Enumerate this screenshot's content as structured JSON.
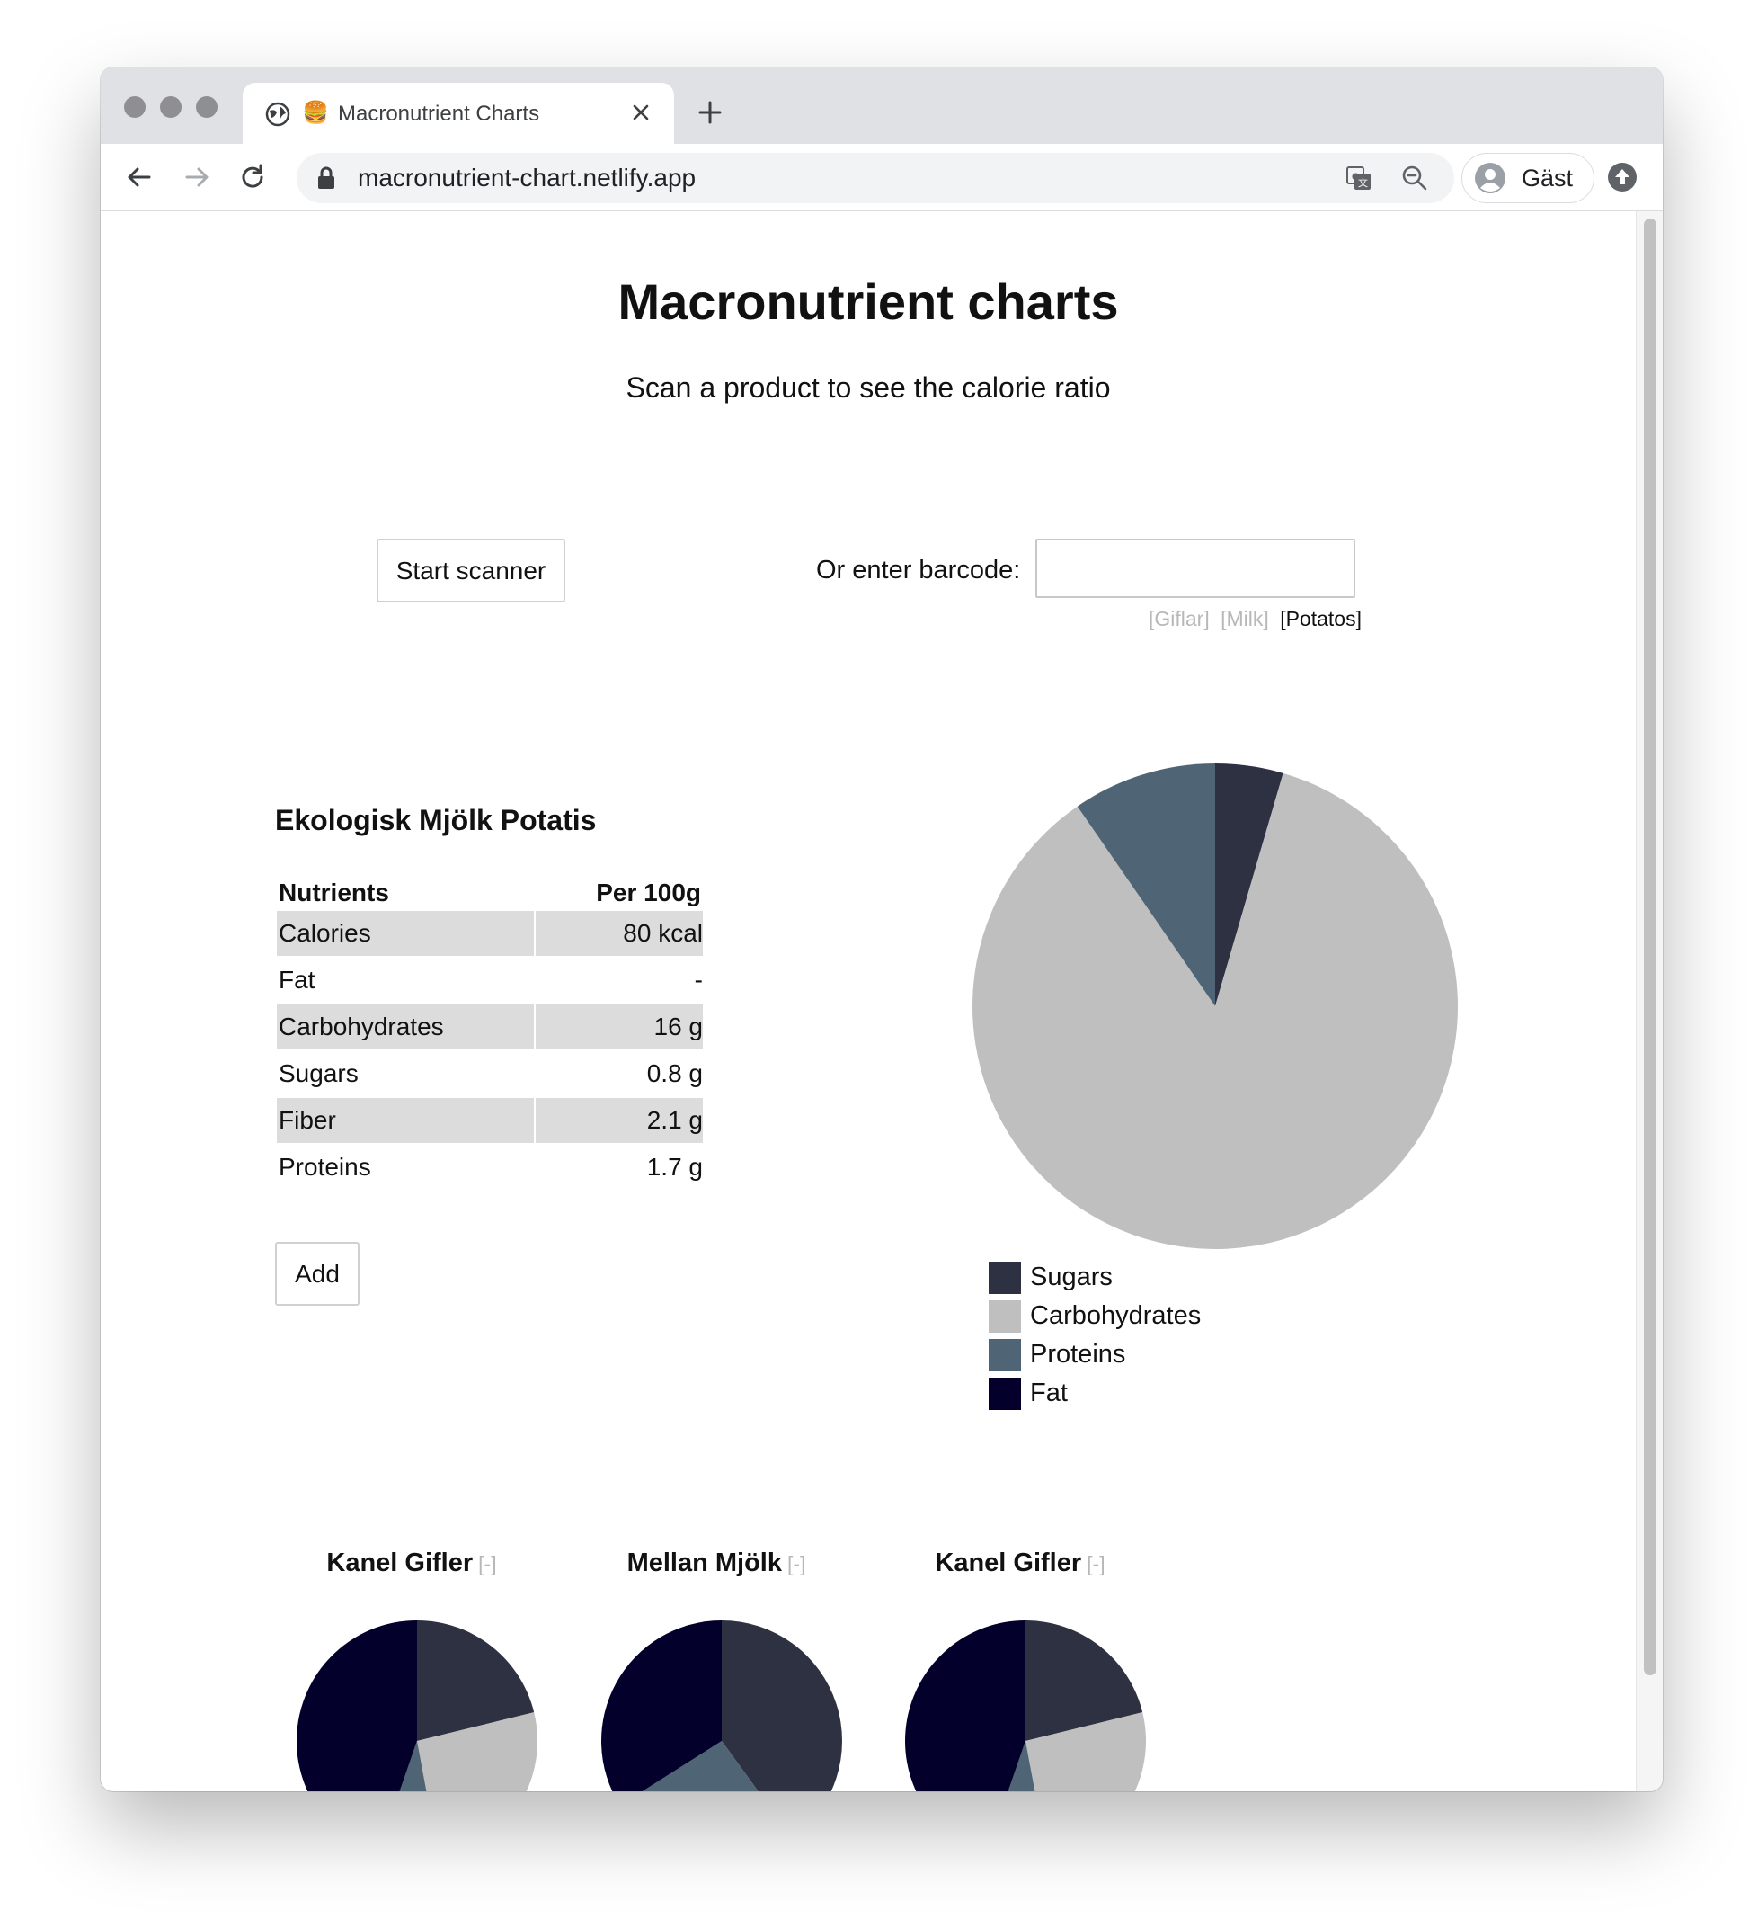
{
  "browser": {
    "tab_title": "Macronutrient Charts",
    "tab_emoji": "🍔",
    "url": "macronutrient-chart.netlify.app",
    "profile_name": "Gäst"
  },
  "page": {
    "title": "Macronutrient charts",
    "subtitle": "Scan a product to see the calorie ratio",
    "start_scanner_label": "Start scanner",
    "barcode_label": "Or enter barcode:",
    "barcode_value": "",
    "samples": [
      {
        "label": "[Giflar]",
        "active": false
      },
      {
        "label": "[Milk]",
        "active": false
      },
      {
        "label": "[Potatos]",
        "active": true
      }
    ]
  },
  "product": {
    "name": "Ekologisk Mjölk Potatis",
    "table_headers": [
      "Nutrients",
      "Per 100g"
    ],
    "rows": [
      {
        "nutrient": "Calories",
        "value": "80 kcal"
      },
      {
        "nutrient": "Fat",
        "value": "-"
      },
      {
        "nutrient": "Carbohydrates",
        "value": "16 g"
      },
      {
        "nutrient": "Sugars",
        "value": "0.8 g"
      },
      {
        "nutrient": "Fiber",
        "value": "2.1 g"
      },
      {
        "nutrient": "Proteins",
        "value": "1.7 g"
      }
    ],
    "add_label": "Add"
  },
  "colors": {
    "Sugars": "#2d3142",
    "Carbohydrates": "#bfbfbf",
    "Proteins": "#4f6575",
    "Fat": "#03012c"
  },
  "chart_data": [
    {
      "type": "pie",
      "categories": [
        "Sugars",
        "Carbohydrates",
        "Proteins",
        "Fat"
      ],
      "values": [
        0.8,
        15.2,
        1.7,
        0
      ],
      "legend": [
        "Sugars",
        "Carbohydrates",
        "Proteins",
        "Fat"
      ]
    },
    {
      "type": "pie",
      "title": "Kanel Gifler",
      "remove_label": "[-]",
      "categories": [
        "Sugars",
        "Carbohydrates",
        "Proteins",
        "Fat"
      ],
      "values": [
        18,
        22,
        7,
        38
      ]
    },
    {
      "type": "pie",
      "title": "Mellan Mjölk",
      "remove_label": "[-]",
      "categories": [
        "Sugars",
        "Carbohydrates",
        "Proteins",
        "Fat"
      ],
      "values": [
        40,
        0,
        26,
        34
      ]
    },
    {
      "type": "pie",
      "title": "Kanel Gifler",
      "remove_label": "[-]",
      "categories": [
        "Sugars",
        "Carbohydrates",
        "Proteins",
        "Fat"
      ],
      "values": [
        18,
        22,
        7,
        38
      ]
    }
  ]
}
